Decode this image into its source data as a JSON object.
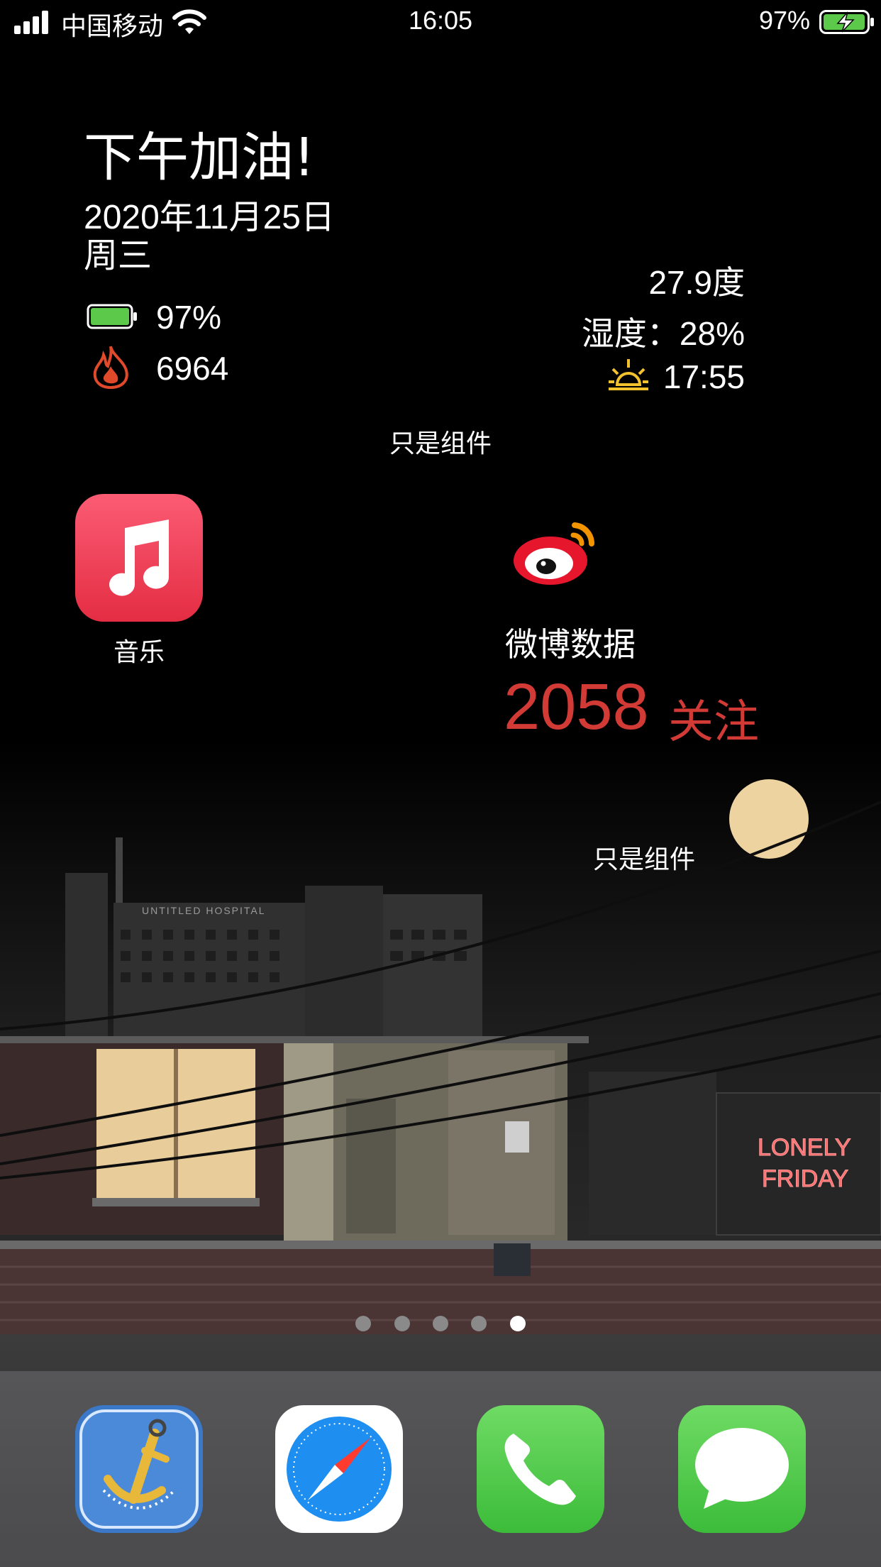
{
  "status_bar": {
    "carrier": "中国移动",
    "time": "16:05",
    "battery_percent": "97%"
  },
  "widget_top": {
    "greeting": "下午加油!",
    "date": "2020年11月25日",
    "weekday": "周三",
    "battery": "97%",
    "steps": "6964",
    "temperature": "27.9度",
    "humidity": "湿度：28%",
    "sunset": "17:55",
    "caption": "只是组件"
  },
  "apps": {
    "music_label": "音乐"
  },
  "weibo": {
    "title": "微博数据",
    "count": "2058",
    "unit": "关注",
    "caption": "只是组件"
  },
  "wallpaper": {
    "sign_hospital": "UNTITLED HOSPITAL",
    "neon_line1": "LONELY",
    "neon_line2": "FRIDAY"
  },
  "page_indicator": {
    "count": 5,
    "active": 5
  },
  "dock": [
    "anchor-app",
    "safari",
    "phone",
    "messages"
  ],
  "colors": {
    "weibo_red": "#d23a36",
    "battery_green": "#5cc94a",
    "sunset_yellow": "#f2c12e"
  }
}
